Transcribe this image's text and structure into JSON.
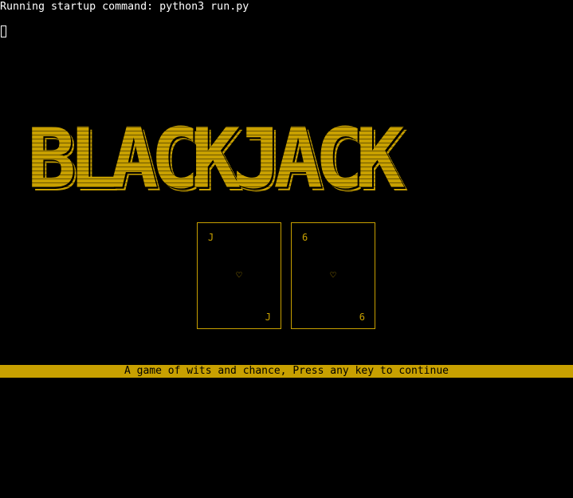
{
  "terminal": {
    "startup_line": "Running startup command: python3 run.py"
  },
  "logo": {
    "text": "BLACKJACK",
    "color": "#c8a000"
  },
  "cards": [
    {
      "rank": "J",
      "suit_icon": "heart-icon",
      "suit": "♡"
    },
    {
      "rank": "6",
      "suit_icon": "heart-icon",
      "suit": "♡"
    }
  ],
  "banner": {
    "text": "A game of wits and chance, Press any key to continue",
    "background": "#c8a000"
  }
}
